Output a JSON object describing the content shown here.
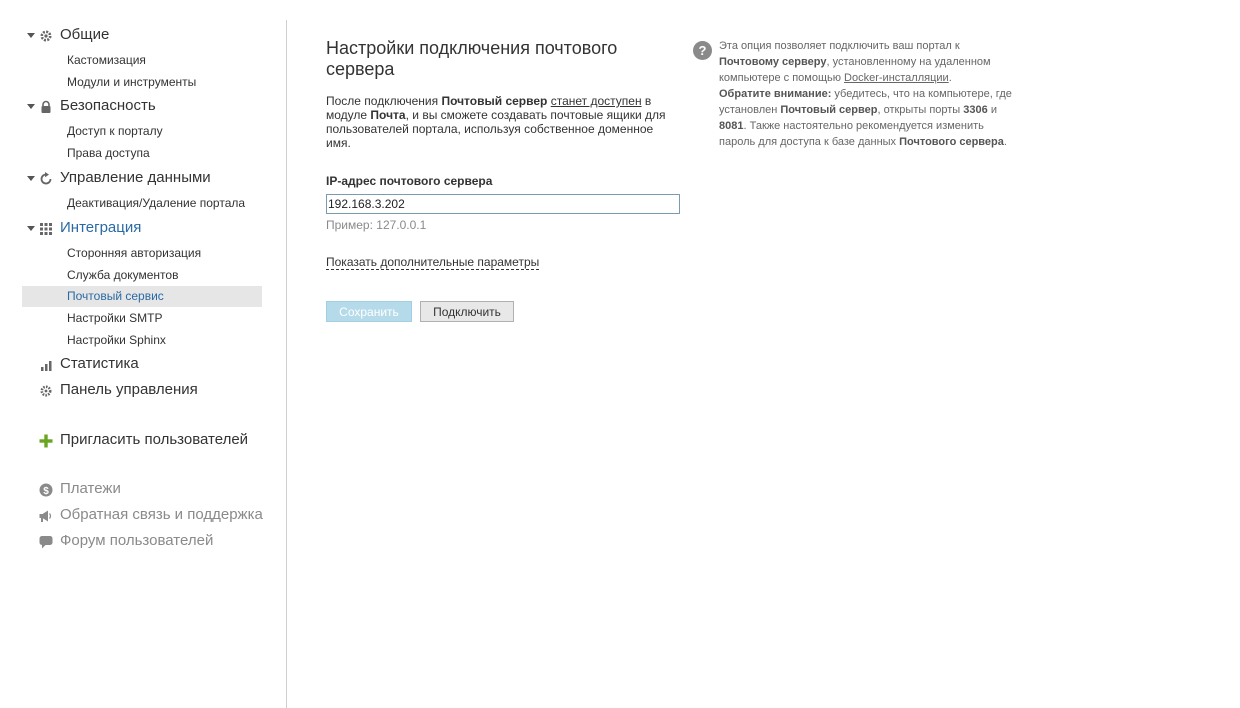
{
  "sidebar": {
    "sections": {
      "general": {
        "label": "Общие",
        "items": [
          "Кастомизация",
          "Модули и инструменты"
        ]
      },
      "security": {
        "label": "Безопасность",
        "items": [
          "Доступ к порталу",
          "Права доступа"
        ]
      },
      "data": {
        "label": "Управление данными",
        "items": [
          "Деактивация/Удаление портала"
        ]
      },
      "integration": {
        "label": "Интеграция",
        "items": [
          "Сторонняя авторизация",
          "Служба документов",
          "Почтовый сервис",
          "Настройки SMTP",
          "Настройки Sphinx"
        ]
      },
      "statistics": {
        "label": "Статистика"
      },
      "control_panel": {
        "label": "Панель управления"
      }
    },
    "invite": {
      "label": "Пригласить пользователей"
    },
    "payments": {
      "label": "Платежи"
    },
    "feedback": {
      "label": "Обратная связь и поддержка"
    },
    "forum": {
      "label": "Форум пользователей"
    }
  },
  "main": {
    "title": "Настройки подключения почтового сервера",
    "description": {
      "part1": "После подключения ",
      "bold1": "Почтовый сервер",
      "part2": " ",
      "link": "станет доступен",
      "part3": " в модуле ",
      "bold2": "Почта",
      "part4": ", и вы сможете создавать почтовые ящики для пользователей портала, используя собственное доменное имя."
    },
    "ip_label": "IP-адрес почтового сервера",
    "ip_value": "192.168.3.202",
    "hint": "Пример: 127.0.0.1",
    "more_link": "Показать дополнительные параметры",
    "save_button": "Сохранить",
    "connect_button": "Подключить"
  },
  "help": {
    "icon": "?",
    "t1": "Эта опция позволяет подключить ваш портал к ",
    "b1": "Почтовому серверу",
    "t2": ", установленному на удаленном компьютере с помощью ",
    "link": "Docker-инсталляции",
    "t3": ".",
    "b2": "Обратите внимание:",
    "t4": " убедитесь, что на компьютере, где установлен ",
    "b3": "Почтовый сервер",
    "t5": ", открыты порты ",
    "b4": "3306",
    "t6": " и ",
    "b5": "8081",
    "t7": ". Также настоятельно рекомендуется изменить пароль для доступа к базе данных ",
    "b6": "Почтового сервера",
    "t8": "."
  },
  "colors": {
    "accent": "#2a6aa4",
    "selected_bg": "#e6e6e6",
    "save_button_bg": "#b5dbeb",
    "invite_icon": "#6aa522",
    "muted_text": "#8a8a8a"
  },
  "icons": {
    "general": "gear-icon",
    "security": "lock-icon",
    "data": "refresh-icon",
    "integration": "grid-icon",
    "statistics": "bar-chart-icon",
    "control_panel": "gear-cog-icon",
    "invite": "plus-icon",
    "payments": "dollar-icon",
    "feedback": "megaphone-icon",
    "forum": "speech-bubble-icon",
    "help": "question-icon"
  }
}
